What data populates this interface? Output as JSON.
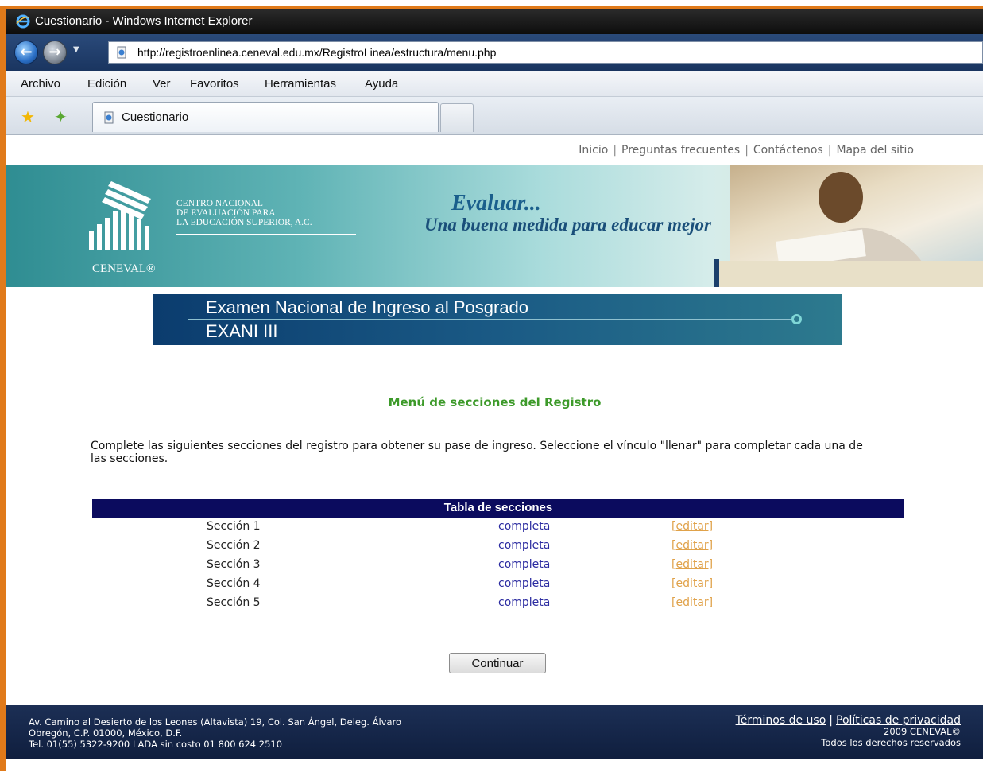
{
  "window": {
    "title": "Cuestionario - Windows Internet Explorer"
  },
  "address": {
    "url": "http://registroenlinea.ceneval.edu.mx/RegistroLinea/estructura/menu.php"
  },
  "menu": {
    "items": [
      "Archivo",
      "Edición",
      "Ver",
      "Favoritos",
      "Herramientas",
      "Ayuda"
    ]
  },
  "tab": {
    "label": "Cuestionario"
  },
  "toplinks": {
    "inicio": "Inicio",
    "faq": "Preguntas frecuentes",
    "contact": "Contáctenos",
    "sitemap": "Mapa del sitio",
    "sep": "|"
  },
  "banner": {
    "org_line1": "CENTRO NACIONAL",
    "org_line2": "DE EVALUACIÓN PARA",
    "org_line3": "LA EDUCACIÓN SUPERIOR, A.C.",
    "logo_text": "CENEVAL®",
    "slogan1": "Evaluar...",
    "slogan2": "Una buena medida para educar mejor"
  },
  "exam": {
    "title": "Examen Nacional de Ingreso al Posgrado",
    "code": "EXANI III"
  },
  "main": {
    "heading": "Menú de secciones del Registro",
    "instructions": "Complete las siguientes secciones del registro para obtener su pase de ingreso. Seleccione el vínculo \"llenar\" para completar cada una de las secciones.",
    "table_title": "Tabla de secciones",
    "rows": [
      {
        "name": "Sección 1",
        "status": "completa",
        "action": "[editar]"
      },
      {
        "name": "Sección 2",
        "status": "completa",
        "action": "[editar]"
      },
      {
        "name": "Sección 3",
        "status": "completa",
        "action": "[editar]"
      },
      {
        "name": "Sección 4",
        "status": "completa",
        "action": "[editar]"
      },
      {
        "name": "Sección 5",
        "status": "completa",
        "action": "[editar]"
      }
    ],
    "continue_label": "Continuar"
  },
  "footer": {
    "address_line1": "Av. Camino al Desierto de los Leones (Altavista) 19, Col. San Ángel, Deleg. Álvaro",
    "address_line2": "Obregón, C.P. 01000, México, D.F.",
    "address_line3": "Tel. 01(55) 5322-9200 LADA sin costo 01 800 624 2510",
    "terms": "Términos de uso",
    "privacy": "Políticas de privacidad",
    "sep": "|",
    "copyright": "2009 CENEVAL©",
    "rights": "Todos los derechos reservados"
  },
  "colors": {
    "accent_orange": "#e07a1a",
    "heading_green": "#3d9a2a",
    "table_header_navy": "#0b0b5e",
    "status_blue": "#2a2aa0",
    "edit_link_orange": "#e0a24a"
  }
}
